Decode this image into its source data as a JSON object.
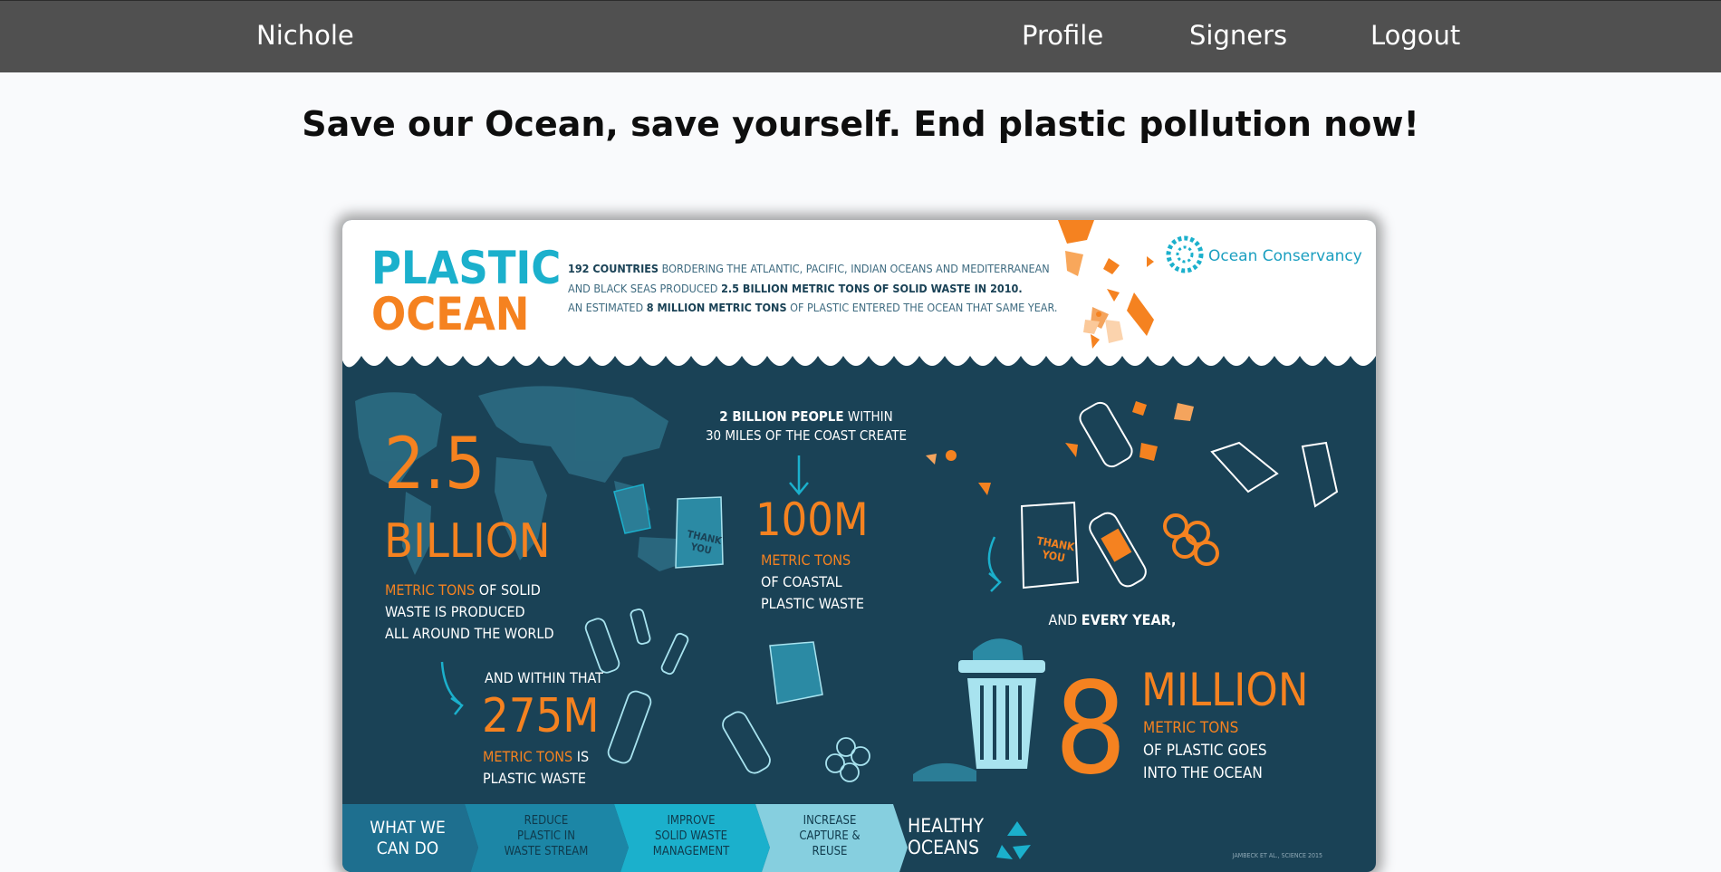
{
  "nav": {
    "user_name": "Nichole",
    "profile": "Profile",
    "signers": "Signers",
    "logout": "Logout"
  },
  "page_title": "Save our Ocean, save yourself. End plastic pollution now!",
  "infographic": {
    "title_line1": "PLASTIC",
    "title_line2": "OCEAN",
    "intro_line1_bold": "192 COUNTRIES",
    "intro_line1_rest": "BORDERING THE ATLANTIC, PACIFIC, INDIAN OCEANS AND MEDITERRANEAN",
    "intro_line2_pre": "AND BLACK SEAS PRODUCED",
    "intro_line2_bold": "2.5 BILLION METRIC TONS OF SOLID WASTE IN 2010.",
    "intro_line3_pre": "AN ESTIMATED",
    "intro_line3_bold": "8 MILLION METRIC TONS",
    "intro_line3_rest": "OF  PLASTIC ENTERED THE OCEAN THAT SAME YEAR.",
    "org_name": "Ocean Conservancy",
    "stat1_number": "2.5",
    "stat1_unit": "BILLION",
    "stat1_accent": "METRIC TONS",
    "stat1_line1_rest": "OF SOLID",
    "stat1_line2": "WASTE IS PRODUCED",
    "stat1_line3": "ALL AROUND THE WORLD",
    "people_bold": "2 BILLION PEOPLE",
    "people_rest": "WITHIN",
    "people_line2": "30 MILES OF THE COAST CREATE",
    "stat2_number": "100M",
    "stat2_accent": "METRIC TONS",
    "stat2_line2": "OF COASTAL",
    "stat2_line3": "PLASTIC WASTE",
    "within_label": "AND WITHIN THAT",
    "stat3_number": "275M",
    "stat3_accent": "METRIC TONS",
    "stat3_rest": "IS",
    "stat3_line2": "PLASTIC WASTE",
    "every_year_pre": "AND",
    "every_year_bold": "EVERY YEAR,",
    "stat4_number": "8",
    "stat4_unit": "MILLION",
    "stat4_accent": "METRIC TONS",
    "stat4_line2": "OF PLASTIC GOES",
    "stat4_line3": "INTO THE OCEAN",
    "bag_text_1": "THANK",
    "bag_text_2": "YOU",
    "steps": [
      {
        "line1": "WHAT WE",
        "line2": "CAN DO",
        "line3": ""
      },
      {
        "line1": "REDUCE",
        "line2": "PLASTIC IN",
        "line3": "WASTE STREAM"
      },
      {
        "line1": "IMPROVE",
        "line2": "SOLID WASTE",
        "line3": "MANAGEMENT"
      },
      {
        "line1": "INCREASE",
        "line2": "CAPTURE &",
        "line3": "REUSE"
      }
    ],
    "healthy_line1": "HEALTHY",
    "healthy_line2": "OCEANS",
    "citation": "JAMBECK ET AL., SCIENCE 2015"
  },
  "colors": {
    "navbar": "#505050",
    "ocean_dark": "#1a4256",
    "accent_orange": "#f58220",
    "accent_teal": "#1bb0cc"
  }
}
